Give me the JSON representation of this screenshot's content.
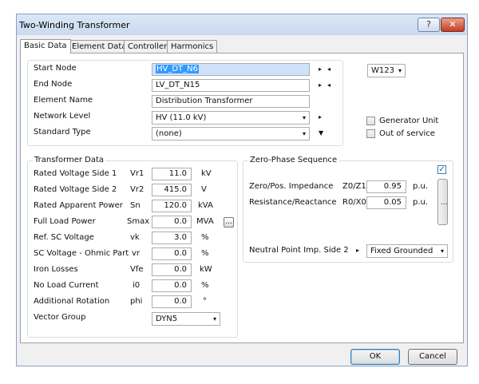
{
  "window": {
    "title": "Two-Winding Transformer",
    "help_label": "?",
    "close_label": "✕"
  },
  "tabs": [
    {
      "label": "Basic Data"
    },
    {
      "label": "Element Data"
    },
    {
      "label": "Controller"
    },
    {
      "label": "Harmonics"
    }
  ],
  "general": {
    "start_node_label": "Start Node",
    "start_node_value": "HV_DT_N6",
    "end_node_label": "End Node",
    "end_node_value": "LV_DT_N15",
    "element_name_label": "Element Name",
    "element_name_value": "Distribution Transformer",
    "network_level_label": "Network Level",
    "network_level_value": "HV (11.0 kV)",
    "standard_type_label": "Standard Type",
    "standard_type_value": "(none)",
    "variant_value": "W123",
    "generator_unit_label": "Generator Unit",
    "out_of_service_label": "Out of service"
  },
  "transformer_data": {
    "title": "Transformer Data",
    "rows": [
      {
        "label": "Rated Voltage Side 1",
        "symbol": "Vr1",
        "value": "11.0",
        "unit": "kV"
      },
      {
        "label": "Rated Voltage Side 2",
        "symbol": "Vr2",
        "value": "415.0",
        "unit": "V"
      },
      {
        "label": "Rated Apparent Power",
        "symbol": "Sn",
        "value": "120.0",
        "unit": "kVA"
      },
      {
        "label": "Full Load Power",
        "symbol": "Smax",
        "value": "0.0",
        "unit": "MVA"
      },
      {
        "label": "Ref. SC Voltage",
        "symbol": "vk",
        "value": "3.0",
        "unit": "%"
      },
      {
        "label": "SC Voltage - Ohmic Part",
        "symbol": "vr",
        "value": "0.0",
        "unit": "%"
      },
      {
        "label": "Iron Losses",
        "symbol": "Vfe",
        "value": "0.0",
        "unit": "kW"
      },
      {
        "label": "No Load Current",
        "symbol": "i0",
        "value": "0.0",
        "unit": "%"
      },
      {
        "label": "Additional Rotation",
        "symbol": "phi",
        "value": "0.0",
        "unit": "°"
      }
    ],
    "vector_group_label": "Vector Group",
    "vector_group_value": "DYN5",
    "more_button_label": "..."
  },
  "zero_phase": {
    "title": "Zero-Phase Sequence",
    "impedance_label": "Zero/Pos. Impedance",
    "impedance_symbol": "Z0/Z1",
    "impedance_value": "0.95",
    "impedance_unit": "p.u.",
    "resistance_label": "Resistance/Reactance",
    "resistance_symbol": "R0/X0",
    "resistance_value": "0.05",
    "resistance_unit": "p.u.",
    "neutral_label": "Neutral Point Imp. Side 2",
    "neutral_value": "Fixed Grounded",
    "more_button_label": "..."
  },
  "footer": {
    "ok_label": "OK",
    "cancel_label": "Cancel"
  },
  "icons": {
    "play": "▸",
    "back": "◂",
    "dropdown": "▾",
    "filter": "▼",
    "check": "✓"
  }
}
